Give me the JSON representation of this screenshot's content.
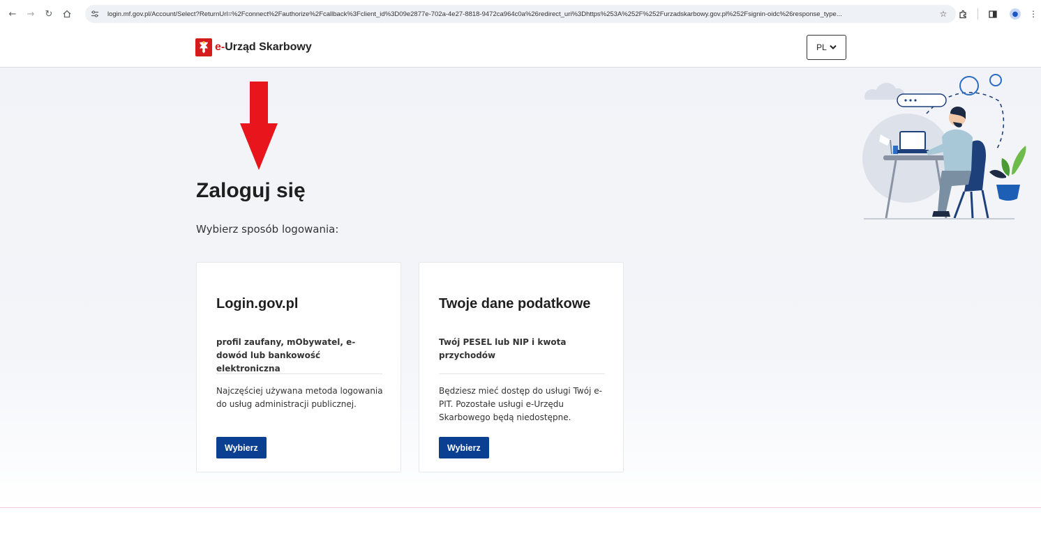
{
  "browser": {
    "url": "login.mf.gov.pl/Account/Select?ReturnUrl=%2Fconnect%2Fauthorize%2Fcallback%3Fclient_id%3D09e2877e-702a-4e27-8818-9472ca964c0a%26redirect_uri%3Dhttps%253A%252F%252Furzadskarbowy.gov.pl%252Fsignin-oidc%26response_type...",
    "icons": [
      "back-icon",
      "forward-icon",
      "reload-icon",
      "home-icon",
      "site-settings-icon",
      "bookmark-star-icon",
      "extensions-icon",
      "side-panel-icon",
      "profile-icon",
      "menu-icon"
    ]
  },
  "header": {
    "brand_prefix": "e-",
    "brand_name": "Urząd Skarbowy",
    "lang_value": "PL"
  },
  "main": {
    "title": "Zaloguj się",
    "subtitle": "Wybierz sposób logowania:",
    "cards": [
      {
        "title": "Login.gov.pl",
        "lead": "profil zaufany, mObywatel, e-dowód lub bankowość elektroniczna",
        "desc": "Najczęściej używana metoda logowania do usług administracji publicznej.",
        "button": "Wybierz"
      },
      {
        "title": "Twoje dane podatkowe",
        "lead": "Twój PESEL lub NIP i kwota przychodów",
        "desc": "Będziesz mieć dostęp do usługi Twój e-PIT. Pozostałe usługi e-Urzędu Skarbowego będą niedostępne.",
        "button": "Wybierz"
      }
    ]
  },
  "colors": {
    "accent_button": "#0b3f91",
    "brand_red": "#d41c1c",
    "arrow_red": "#e8161c",
    "page_bg": "#f1f3f8"
  }
}
